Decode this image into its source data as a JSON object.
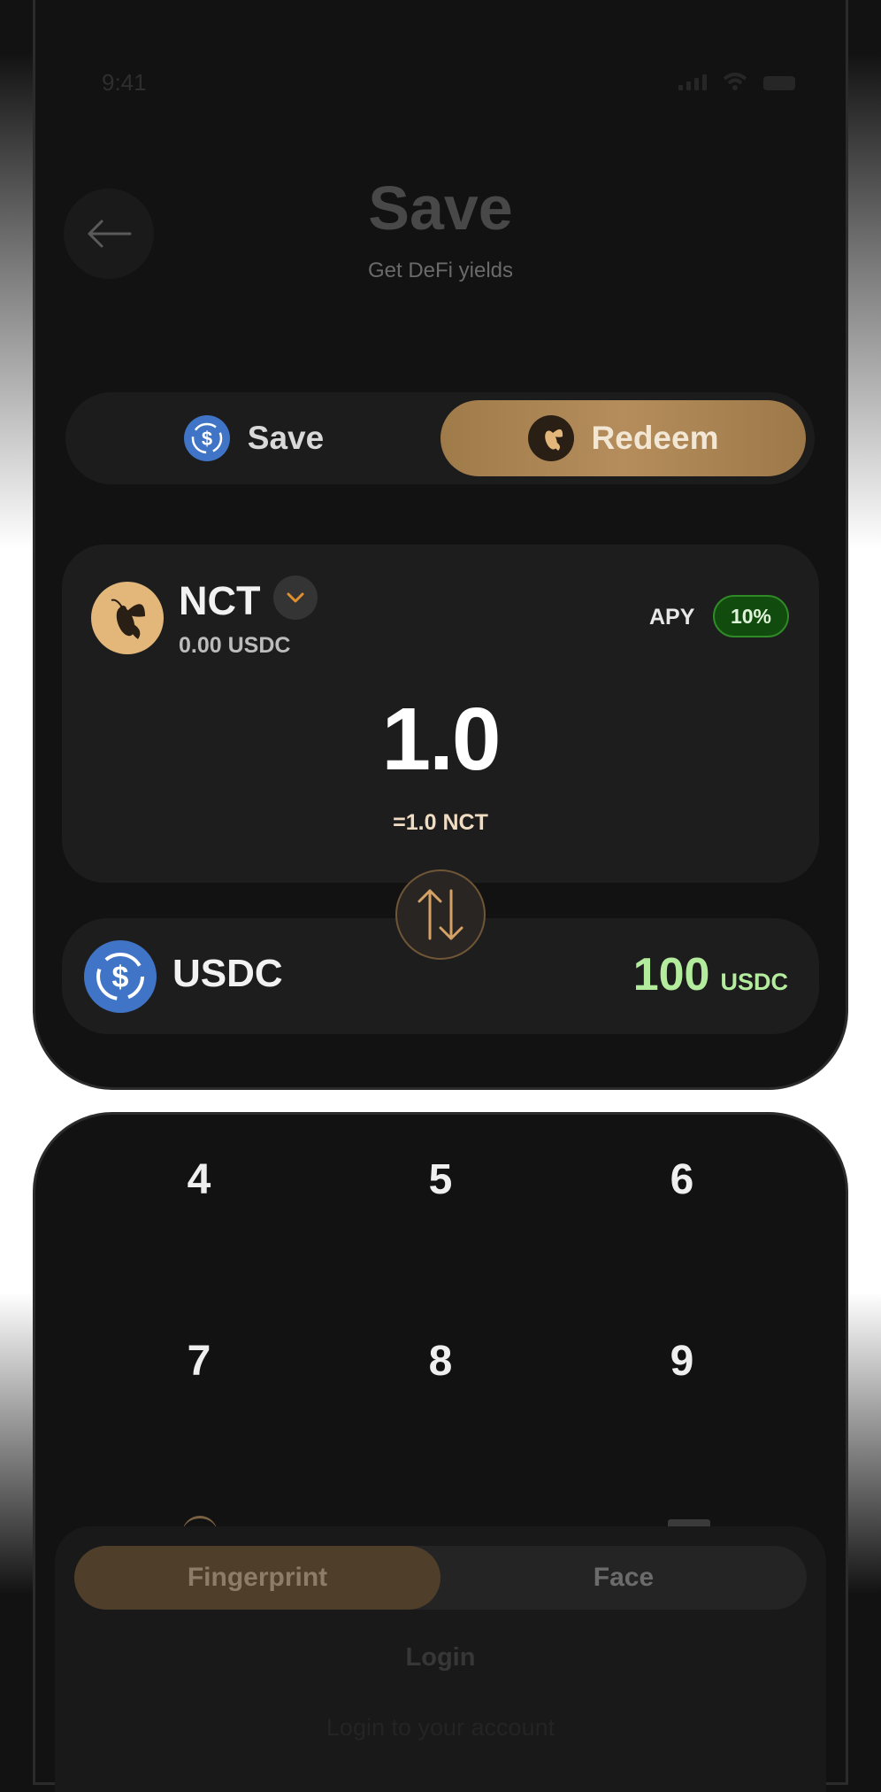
{
  "status_bar": {
    "time": "9:41"
  },
  "header": {
    "title": "Save",
    "subtitle": "Get DeFi yields"
  },
  "mode_toggle": {
    "save_label": "Save",
    "redeem_label": "Redeem",
    "selected": "Redeem"
  },
  "from_token": {
    "symbol": "NCT",
    "balance": "0.00 USDC",
    "apy_label": "APY",
    "apy_value": "10%",
    "amount": "1.0",
    "equivalent": "=1.0 NCT"
  },
  "to_token": {
    "symbol": "USDC",
    "amount": "100",
    "unit": "USDC"
  },
  "keypad": {
    "keys": [
      "4",
      "5",
      "6",
      "7",
      "8",
      "9"
    ]
  },
  "login_sheet": {
    "tab_fingerprint": "Fingerprint",
    "tab_face": "Face",
    "selected_tab": "Fingerprint",
    "title": "Login",
    "subtitle": "Login to your account"
  },
  "colors": {
    "accent_gold": "#b58d5c",
    "usdc_blue": "#3f74c6",
    "positive_green": "#b4ec9e",
    "apy_badge_bg": "#124b0e",
    "background": "#121212"
  },
  "icons": [
    "arrow-left-icon",
    "usdc-coin-icon",
    "bee-logo-icon",
    "chevron-down-icon",
    "swap-vertical-icon",
    "wifi-icon",
    "signal-icon",
    "battery-icon"
  ]
}
